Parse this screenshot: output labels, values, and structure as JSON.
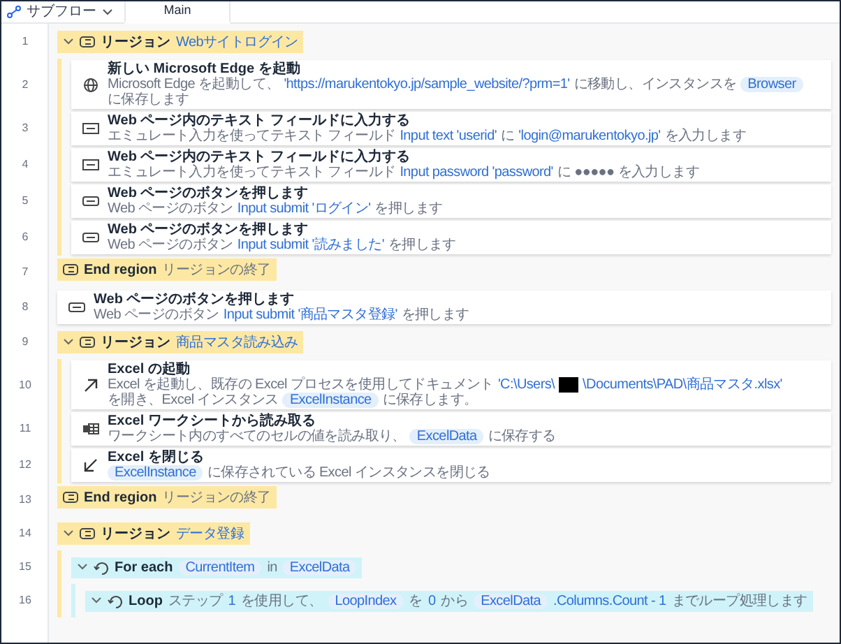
{
  "subflows": {
    "label": "サブフロー"
  },
  "tabs": [
    {
      "label": "Main",
      "selected": true
    }
  ],
  "steps": [
    {
      "line": "1",
      "kind": "region",
      "expanded": true,
      "title": "リージョン",
      "segments": [
        {
          "kind": "value",
          "text": "Webサイトログイン"
        }
      ],
      "children": [
        {
          "line": "2",
          "kind": "launch_browser",
          "title": "新しい Microsoft Edge を起動",
          "segments": [
            {
              "kind": "plain",
              "text": "Microsoft Edge を起動して、"
            },
            {
              "kind": "value",
              "text": "'https://marukentokyo.jp/sample_website/?prm=1'"
            },
            {
              "kind": "plain",
              "text": "に移動し、インスタンスを"
            },
            {
              "kind": "chip",
              "text": "Browser"
            },
            {
              "kind": "plain",
              "text": "に保存します"
            }
          ]
        },
        {
          "line": "3",
          "kind": "input_text",
          "title": "Web ページ内のテキスト フィールドに入力する",
          "segments": [
            {
              "kind": "plain",
              "text": "エミュレート入力を使ってテキスト フィールド"
            },
            {
              "kind": "value",
              "text": "Input text 'userid'"
            },
            {
              "kind": "plain",
              "text": "に"
            },
            {
              "kind": "value",
              "text": "'login@marukentokyo.jp'"
            },
            {
              "kind": "plain",
              "text": "を入力します"
            }
          ]
        },
        {
          "line": "4",
          "kind": "input_text",
          "title": "Web ページ内のテキスト フィールドに入力する",
          "segments": [
            {
              "kind": "plain",
              "text": "エミュレート入力を使ってテキスト フィールド"
            },
            {
              "kind": "value",
              "text": "Input password 'password'"
            },
            {
              "kind": "plain",
              "text": "に ●●●●● を入力します"
            }
          ]
        },
        {
          "line": "5",
          "kind": "press_button",
          "title": "Web ページのボタンを押します",
          "segments": [
            {
              "kind": "plain",
              "text": "Web ページのボタン"
            },
            {
              "kind": "value",
              "text": "Input submit 'ログイン'"
            },
            {
              "kind": "plain",
              "text": "を押します"
            }
          ]
        },
        {
          "line": "6",
          "kind": "press_button",
          "title": "Web ページのボタンを押します",
          "segments": [
            {
              "kind": "plain",
              "text": "Web ページのボタン"
            },
            {
              "kind": "value",
              "text": "Input submit '読みました'"
            },
            {
              "kind": "plain",
              "text": "を押します"
            }
          ]
        }
      ]
    },
    {
      "line": "7",
      "kind": "end_region",
      "title": "End region",
      "segments": [
        {
          "kind": "plain",
          "text": "リージョンの終了"
        }
      ]
    },
    {
      "line": "8",
      "kind": "press_button",
      "title": "Web ページのボタンを押します",
      "segments": [
        {
          "kind": "plain",
          "text": "Web ページのボタン"
        },
        {
          "kind": "value",
          "text": "Input submit '商品マスタ登録'"
        },
        {
          "kind": "plain",
          "text": "を押します"
        }
      ]
    },
    {
      "line": "9",
      "kind": "region",
      "expanded": true,
      "title": "リージョン",
      "segments": [
        {
          "kind": "value",
          "text": "商品マスタ読み込み"
        }
      ],
      "children": [
        {
          "line": "10",
          "kind": "launch_excel",
          "title": "Excel の起動",
          "segments": [
            {
              "kind": "plain",
              "text": "Excel を起動し、既存の Excel プロセスを使用してドキュメント"
            },
            {
              "kind": "value",
              "text": "'C:\\Users\\"
            },
            {
              "kind": "redacted"
            },
            {
              "kind": "value",
              "text": "\\Documents\\PAD\\商品マスタ.xlsx'"
            },
            {
              "kind": "plain",
              "text": "を開き、Excel インスタンス"
            },
            {
              "kind": "chip",
              "text": "ExcelInstance"
            },
            {
              "kind": "plain",
              "text": "に保存します。"
            }
          ]
        },
        {
          "line": "11",
          "kind": "read_excel",
          "title": "Excel ワークシートから読み取る",
          "segments": [
            {
              "kind": "plain",
              "text": "ワークシート内のすべてのセルの値を読み取り、"
            },
            {
              "kind": "chip",
              "text": "ExcelData"
            },
            {
              "kind": "plain",
              "text": "に保存する"
            }
          ]
        },
        {
          "line": "12",
          "kind": "close_excel",
          "title": "Excel を閉じる",
          "segments": [
            {
              "kind": "chip",
              "text": "ExcelInstance"
            },
            {
              "kind": "plain",
              "text": "に保存されている Excel インスタンスを閉じる"
            }
          ]
        }
      ]
    },
    {
      "line": "13",
      "kind": "end_region",
      "title": "End region",
      "segments": [
        {
          "kind": "plain",
          "text": "リージョンの終了"
        }
      ]
    },
    {
      "line": "14",
      "kind": "region",
      "expanded": true,
      "title": "リージョン",
      "segments": [
        {
          "kind": "value",
          "text": "データ登録"
        }
      ],
      "children": [
        {
          "line": "15",
          "kind": "foreach",
          "expanded": true,
          "title": "For each",
          "segments": [
            {
              "kind": "chip",
              "text": "CurrentItem"
            },
            {
              "kind": "plain",
              "text": "in"
            },
            {
              "kind": "chip",
              "text": "ExcelData"
            }
          ],
          "children": [
            {
              "line": "16",
              "kind": "loop",
              "expanded": true,
              "title": "Loop",
              "segments": [
                {
                  "kind": "plain",
                  "text": "ステップ"
                },
                {
                  "kind": "value",
                  "text": "1"
                },
                {
                  "kind": "plain",
                  "text": "を使用して、"
                },
                {
                  "kind": "chip",
                  "text": "LoopIndex"
                },
                {
                  "kind": "plain",
                  "text": "を"
                },
                {
                  "kind": "value",
                  "text": "0"
                },
                {
                  "kind": "plain",
                  "text": "から"
                },
                {
                  "kind": "chip",
                  "text": "ExcelData"
                },
                {
                  "kind": "value",
                  "text": ".Columns.Count - 1"
                },
                {
                  "kind": "plain",
                  "text": "までループ処理します"
                }
              ]
            }
          ]
        }
      ]
    }
  ]
}
